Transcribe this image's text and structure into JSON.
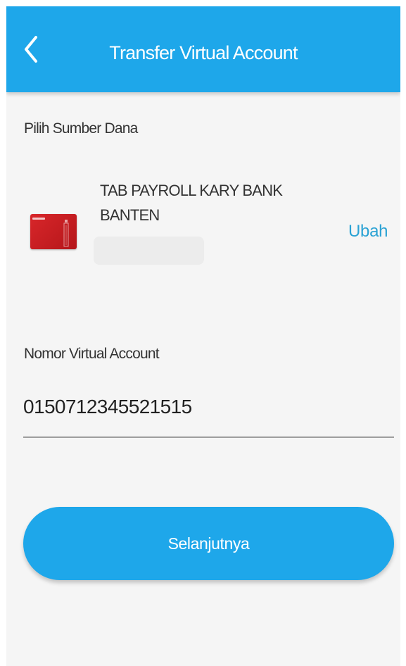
{
  "header": {
    "title": "Transfer Virtual Account",
    "back_icon": "chevron-left-icon"
  },
  "source": {
    "label": "Pilih Sumber Dana",
    "card_icon": "bank-card-icon",
    "account_name": "TAB PAYROLL KARY BANK BANTEN",
    "change_label": "Ubah"
  },
  "virtual_account": {
    "label": "Nomor Virtual Account",
    "value": "0150712345521515"
  },
  "actions": {
    "next_label": "Selanjutnya"
  },
  "colors": {
    "primary": "#1ea7ea",
    "link": "#2aa2d4",
    "card": "#d8262a",
    "background": "#f5f5f5"
  }
}
